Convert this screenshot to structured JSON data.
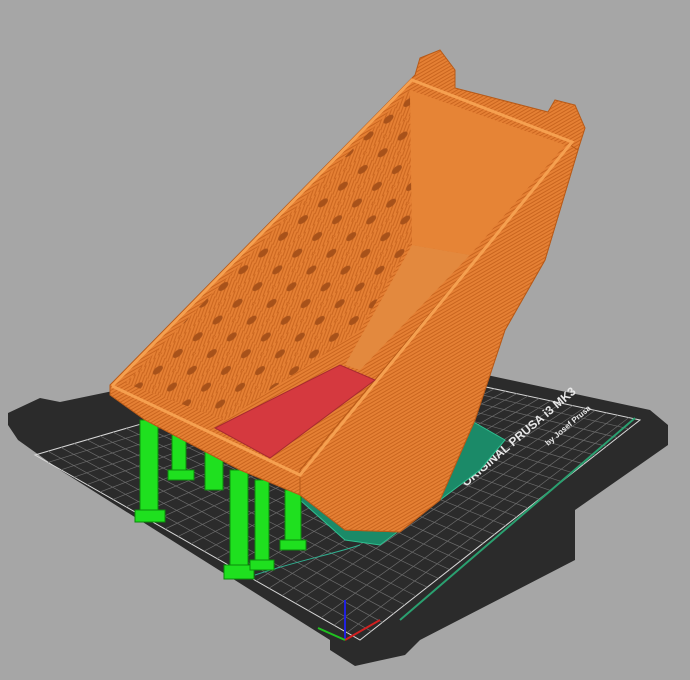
{
  "app": "3D print preview viewport",
  "bed": {
    "label_main": "ORIGINAL PRUSA i3 MK3",
    "label_sub": "by Josef Prusa",
    "bed_color": "#2e2e2e",
    "grid_color": "#cfcfcf"
  },
  "colors": {
    "background": "#a6a6a6",
    "perimeter": "#e07a30",
    "support": "#22e022",
    "bridge": "#d23a40",
    "brim": "#1e8a6a",
    "travel": "#20a080"
  },
  "axes": {
    "x": "#d02020",
    "y": "#20c020",
    "z": "#2020e0"
  }
}
